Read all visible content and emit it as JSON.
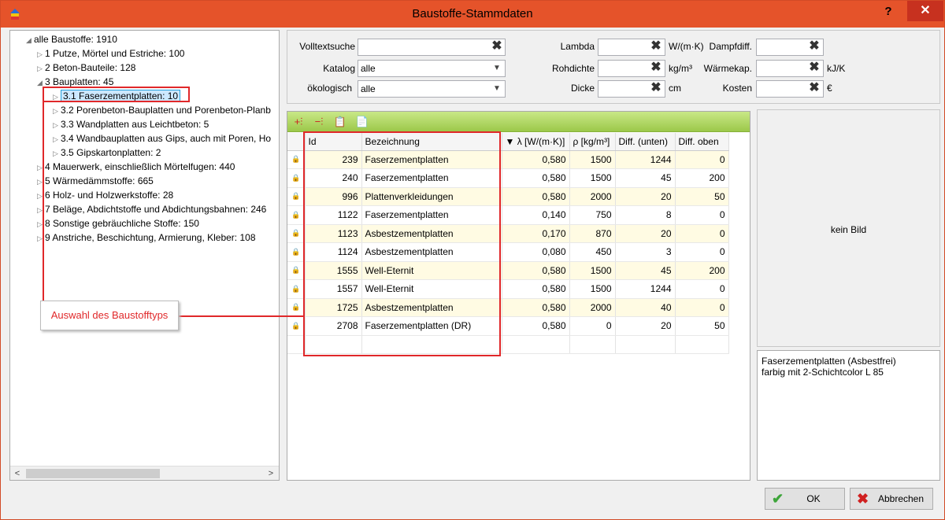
{
  "window": {
    "title": "Baustoffe-Stammdaten",
    "help": "?",
    "close": "✕"
  },
  "tree": {
    "nodes": [
      {
        "glyph": "◢",
        "label": "alle Baustoffe: 1910"
      },
      {
        "glyph": "▷",
        "label": "1 Putze, Mörtel und Estriche: 100"
      },
      {
        "glyph": "▷",
        "label": "2 Beton-Bauteile: 128"
      },
      {
        "glyph": "◢",
        "label": "3 Bauplatten: 45"
      },
      {
        "glyph": "▷",
        "label": "3.1 Faserzementplatten: 10"
      },
      {
        "glyph": "▷",
        "label": "3.2 Porenbeton-Bauplatten und Porenbeton-Planb"
      },
      {
        "glyph": "▷",
        "label": "3.3 Wandplatten aus Leichtbeton: 5"
      },
      {
        "glyph": "▷",
        "label": "3.4 Wandbauplatten aus Gips, auch mit Poren, Ho"
      },
      {
        "glyph": "▷",
        "label": "3.5 Gipskartonplatten: 2"
      },
      {
        "glyph": "▷",
        "label": "4 Mauerwerk, einschließlich Mörtelfugen: 440"
      },
      {
        "glyph": "▷",
        "label": "5 Wärmedämmstoffe: 665"
      },
      {
        "glyph": "▷",
        "label": "6 Holz- und Holzwerkstoffe: 28"
      },
      {
        "glyph": "▷",
        "label": "7 Beläge, Abdichtstoffe und Abdichtungsbahnen: 246"
      },
      {
        "glyph": "▷",
        "label": "8 Sonstige gebräuchliche Stoffe: 150"
      },
      {
        "glyph": "▷",
        "label": "9 Anstriche, Beschichtung, Armierung, Kleber: 108"
      }
    ],
    "selected_index": 4
  },
  "filters": {
    "volltext_label": "Volltextsuche",
    "volltext_value": "",
    "katalog_label": "Katalog",
    "katalog_value": "alle",
    "oekologisch_label": "ökologisch",
    "oekologisch_value": "alle",
    "lambda_label": "Lambda",
    "lambda_value": "",
    "lambda_unit": "W/(m·K)",
    "rohdichte_label": "Rohdichte",
    "rohdichte_value": "",
    "rohdichte_unit": "kg/m³",
    "dicke_label": "Dicke",
    "dicke_value": "",
    "dicke_unit": "cm",
    "dampf_label": "Dampfdiff.",
    "dampf_value": "",
    "waerme_label": "Wärmekap.",
    "waerme_value": "",
    "waerme_unit": "kJ/K",
    "kosten_label": "Kosten",
    "kosten_value": "",
    "kosten_unit": "€"
  },
  "grid": {
    "columns": [
      "Id",
      "Bezeichnung",
      "▼ λ [W/(m·K)]",
      "ρ [kg/m³]",
      "Diff. (unten)",
      "Diff. oben"
    ],
    "rows": [
      [
        "239",
        "Faserzementplatten",
        "0,580",
        "1500",
        "1244",
        "0"
      ],
      [
        "240",
        "Faserzementplatten",
        "0,580",
        "1500",
        "45",
        "200"
      ],
      [
        "996",
        "Plattenverkleidungen",
        "0,580",
        "2000",
        "20",
        "50"
      ],
      [
        "1122",
        "Faserzementplatten",
        "0,140",
        "750",
        "8",
        "0"
      ],
      [
        "1123",
        "Asbestzementplatten",
        "0,170",
        "870",
        "20",
        "0"
      ],
      [
        "1124",
        "Asbestzementplatten",
        "0,080",
        "450",
        "3",
        "0"
      ],
      [
        "1555",
        "Well-Eternit",
        "0,580",
        "1500",
        "45",
        "200"
      ],
      [
        "1557",
        "Well-Eternit",
        "0,580",
        "1500",
        "1244",
        "0"
      ],
      [
        "1725",
        "Asbestzementplatten",
        "0,580",
        "2000",
        "40",
        "0"
      ],
      [
        "2708",
        "Faserzementplatten  (DR)",
        "0,580",
        "0",
        "20",
        "50"
      ]
    ]
  },
  "image_panel": {
    "text": "kein Bild"
  },
  "description": {
    "line1": "Faserzementplatten  (Asbestfrei)",
    "line2": "farbig mit 2-Schichtcolor L 85"
  },
  "buttons": {
    "ok": "OK",
    "cancel": "Abbrechen"
  },
  "annotation": {
    "callout": "Auswahl des Baustofftyps"
  },
  "colors": {
    "accent": "#e5532a",
    "annotation": "#e0282a",
    "toolbar": "#9cc84a"
  }
}
